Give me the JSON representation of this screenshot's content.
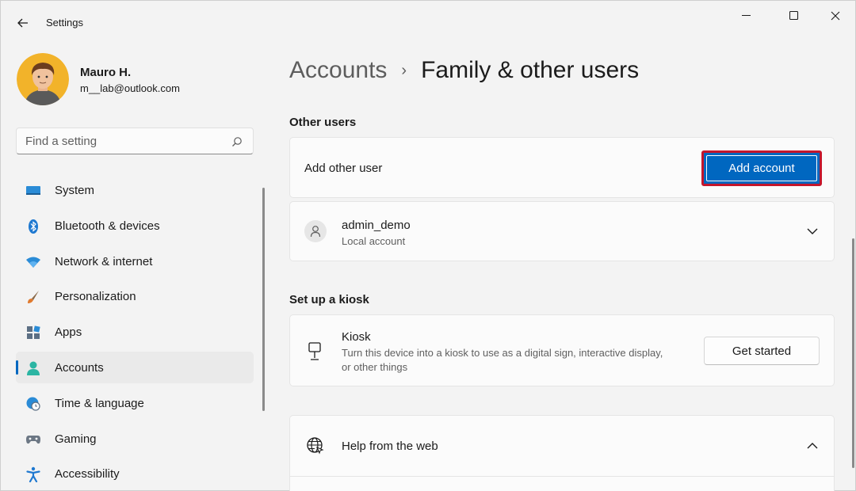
{
  "window": {
    "title": "Settings"
  },
  "profile": {
    "name": "Mauro H.",
    "email": "m__lab@outlook.com"
  },
  "search": {
    "placeholder": "Find a setting"
  },
  "sidebar": {
    "items": [
      {
        "label": "System",
        "icon": "system-icon"
      },
      {
        "label": "Bluetooth & devices",
        "icon": "bluetooth-icon"
      },
      {
        "label": "Network & internet",
        "icon": "wifi-icon"
      },
      {
        "label": "Personalization",
        "icon": "brush-icon"
      },
      {
        "label": "Apps",
        "icon": "apps-icon"
      },
      {
        "label": "Accounts",
        "icon": "account-icon",
        "selected": true
      },
      {
        "label": "Time & language",
        "icon": "clock-globe-icon"
      },
      {
        "label": "Gaming",
        "icon": "gamepad-icon"
      },
      {
        "label": "Accessibility",
        "icon": "accessibility-icon"
      }
    ]
  },
  "breadcrumb": {
    "parent": "Accounts",
    "separator": "›",
    "current": "Family & other users"
  },
  "other_users": {
    "section_title": "Other users",
    "add_label": "Add other user",
    "add_button": "Add account",
    "user": {
      "name": "admin_demo",
      "type": "Local account"
    }
  },
  "kiosk": {
    "section_title": "Set up a kiosk",
    "title": "Kiosk",
    "description_line1": "Turn this device into a kiosk to use as a digital sign, interactive display,",
    "description_line2": "or other things",
    "button": "Get started"
  },
  "help": {
    "title": "Help from the web"
  },
  "colors": {
    "accent": "#0067c0",
    "highlight_border": "#c4162c"
  }
}
